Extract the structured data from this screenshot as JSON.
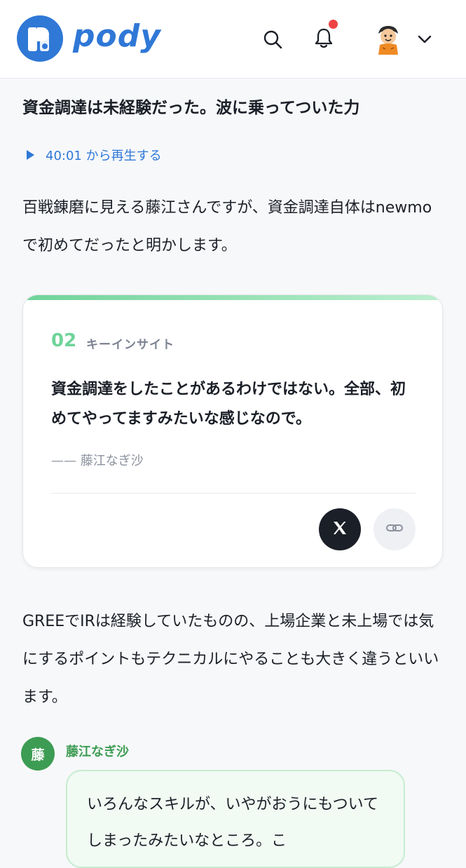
{
  "header": {
    "logo_text": "pody",
    "icons": [
      "pody-logo-icon",
      "search-icon",
      "bell-icon",
      "avatar",
      "chevron-down-icon"
    ]
  },
  "section": {
    "heading": "資金調達は未経験だった。波に乗ってついた力",
    "play_label": "40:01 から再生する",
    "paragraph1": "百戦錬磨に見える藤江さんですが、資金調達自体はnewmoで初めてだったと明かします。"
  },
  "insight_card": {
    "number": "02",
    "tag": "キーインサイト",
    "quote": "資金調達をしたことがあるわけではない。全部、初めてやってますみたいな感じなので。",
    "author": "—— 藤江なぎ沙",
    "share_x_icon": "x-icon",
    "share_link_icon": "link-icon"
  },
  "paragraph2": "GREEでIRは経験していたものの、上場企業と未上場では気にするポイントもテクニカルにやることも大きく違うといいます。",
  "speaker": {
    "initial": "藤",
    "name": "藤江なぎ沙",
    "speech": "いろんなスキルが、いやがおうにもついてしまったみたいなところ。こ"
  },
  "colors": {
    "brand_blue": "#2f78d6",
    "accent_green": "#6fd39a",
    "speaker_green": "#3d9c53",
    "notification_red": "#ef4444"
  }
}
